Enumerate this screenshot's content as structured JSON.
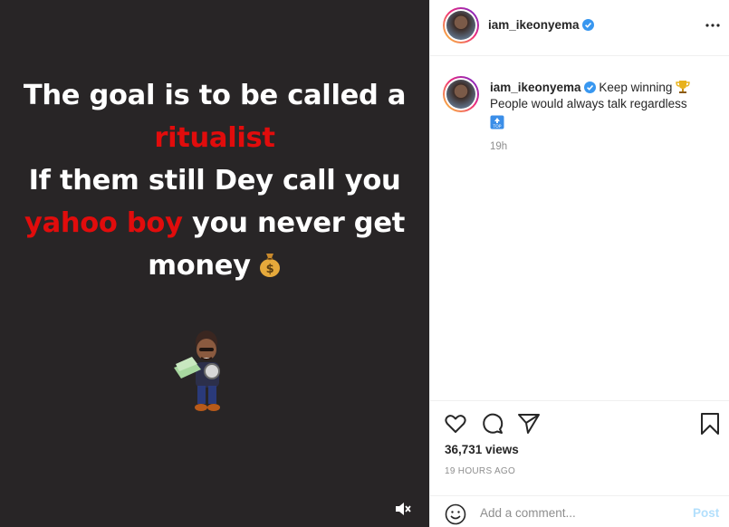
{
  "post": {
    "quote": {
      "line1": "The goal is to be called a",
      "line2_red": "ritualist",
      "line3": "If them still Dey call you",
      "line4_red": "yahoo boy",
      "line4_rest": " you never get",
      "line5": "money"
    },
    "icons": {
      "money_bag": "money-bag-emoji",
      "sticker": "man-with-money-sticker",
      "mute": "speaker-muted-icon"
    },
    "colors": {
      "background": "#282526",
      "accent_red": "#e10c0c",
      "text": "#ffffff"
    }
  },
  "sidebar": {
    "header": {
      "username": "iam_ikeonyema",
      "more_icon": "more-options-icon",
      "verified_icon": "verified-badge-icon"
    },
    "caption": {
      "username": "iam_ikeonyema",
      "text1": "Keep winning",
      "trophy": "trophy-emoji",
      "text2": "People would always talk regardless",
      "top_icon": "top-arrow-emoji"
    },
    "time": "19h",
    "views": "36,731 views",
    "posted_ago": "19 HOURS AGO",
    "comment": {
      "placeholder": "Add a comment...",
      "post_label": "Post"
    },
    "colors": {
      "verified_blue": "#3897f0",
      "post_disabled": "#b2dffc",
      "muted_text": "#8e8e8e"
    }
  }
}
